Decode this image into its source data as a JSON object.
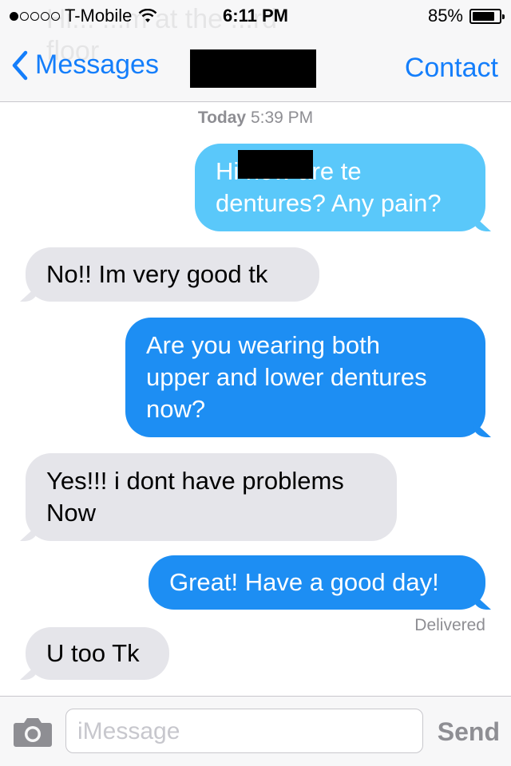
{
  "status": {
    "carrier": "T-Mobile",
    "time": "6:11 PM",
    "battery": "85%",
    "battery_level": 0.85,
    "signal_bars": 1
  },
  "ghost_text": "Hi... ...m at the ...rd floor",
  "nav": {
    "back_label": "Messages",
    "action_label": "Contact"
  },
  "thread": {
    "day": "Today",
    "time": "5:39 PM",
    "messages": [
      {
        "from": "me",
        "lines": [
          "Hi            how are te",
          "dentures? Any pain?"
        ]
      },
      {
        "from": "them",
        "lines": [
          "No!! Im very  good tk"
        ]
      },
      {
        "from": "me",
        "lines": [
          "Are you wearing both",
          "upper and lower dentures",
          "now?"
        ]
      },
      {
        "from": "them",
        "lines": [
          "Yes!!! i dont have problems",
          "Now"
        ]
      },
      {
        "from": "me",
        "lines": [
          "Great! Have a good day!"
        ]
      },
      {
        "from": "them",
        "lines": [
          "U too Tk"
        ]
      }
    ],
    "delivered": "Delivered"
  },
  "composer": {
    "placeholder": "iMessage",
    "send_label": "Send"
  },
  "colors": {
    "accent": "#147efb",
    "bubble_out": "#1d8ef3",
    "bubble_out_light": "#5ac8fa",
    "bubble_in": "#e5e5ea"
  },
  "icons": [
    "back-chevron-icon",
    "wifi-icon",
    "battery-icon",
    "camera-icon"
  ]
}
